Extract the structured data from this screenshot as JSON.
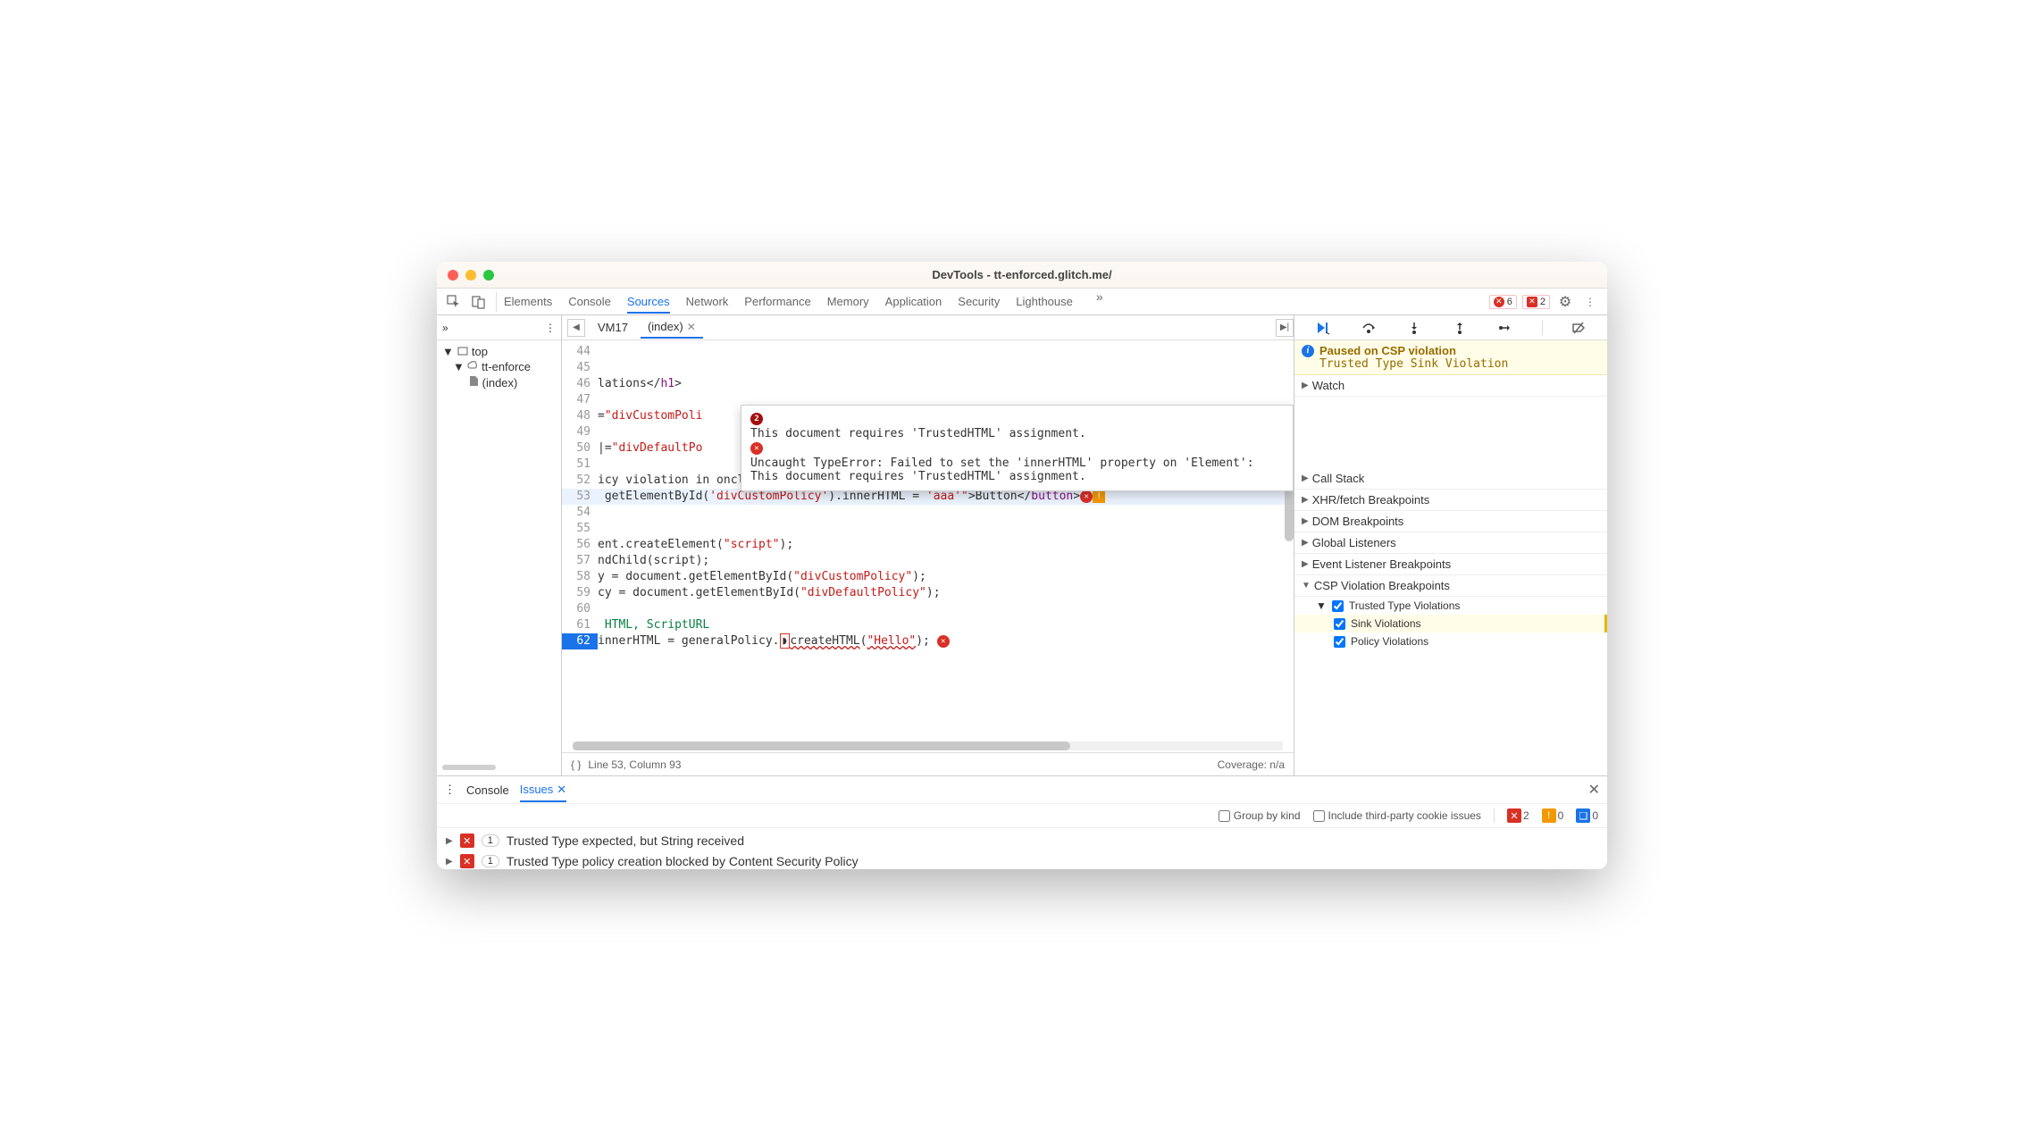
{
  "window": {
    "title": "DevTools - tt-enforced.glitch.me/"
  },
  "main_tabs": {
    "items": [
      "Elements",
      "Console",
      "Sources",
      "Network",
      "Performance",
      "Memory",
      "Application",
      "Security",
      "Lighthouse"
    ],
    "active": "Sources",
    "error_count": "6",
    "issue_count": "2"
  },
  "sidebar": {
    "top": "top",
    "origin": "tt-enforce",
    "file": "(index)"
  },
  "editor": {
    "tabs": {
      "vm": "VM17",
      "index": "(index)"
    },
    "footer_pos": "Line 53, Column 93",
    "footer_coverage": "Coverage: n/a",
    "lines": [
      {
        "n": "44",
        "t": ""
      },
      {
        "n": "45",
        "t": ""
      },
      {
        "n": "46",
        "pre": "lations</",
        "tag": "h1",
        "suf": ">"
      },
      {
        "n": "47",
        "t": ""
      },
      {
        "n": "48",
        "pre": "=",
        "str": "\"divCustomPoli"
      },
      {
        "n": "49",
        "t": ""
      },
      {
        "n": "50",
        "pre": "|=",
        "str": "\"divDefaultPo"
      },
      {
        "n": "51",
        "t": ""
      },
      {
        "n": "52",
        "raw": "icy violation in onclick: <button type=\"button\""
      },
      {
        "n": "53",
        "code": "getElementById('divCustomPolicy').innerHTML = 'aaa'\">Button</button>",
        "hl": true
      },
      {
        "n": "54",
        "t": ""
      },
      {
        "n": "55",
        "t": ""
      },
      {
        "n": "56",
        "code56": "ent.createElement(\"script\");"
      },
      {
        "n": "57",
        "code57": "ndChild(script);"
      },
      {
        "n": "58",
        "code58": "y = document.getElementById(\"divCustomPolicy\");"
      },
      {
        "n": "59",
        "code59": "cy = document.getElementById(\"divDefaultPolicy\");"
      },
      {
        "n": "60",
        "t": ""
      },
      {
        "n": "61",
        "cm": "HTML, ScriptURL"
      },
      {
        "n": "62",
        "code62": "innerHTML = generalPolicy.createHTML(\"Hello\");",
        "exec": true
      }
    ]
  },
  "tooltip": {
    "count": "2",
    "line1": "This document requires 'TrustedHTML' assignment.",
    "line2": "Uncaught TypeError: Failed to set the 'innerHTML' property on 'Element': This document requires 'TrustedHTML' assignment."
  },
  "debug": {
    "paused_title": "Paused on CSP violation",
    "paused_sub": "Trusted Type Sink Violation",
    "sections": {
      "watch": "Watch",
      "callstack": "Call Stack",
      "xhr": "XHR/fetch Breakpoints",
      "dom": "DOM Breakpoints",
      "global": "Global Listeners",
      "event": "Event Listener Breakpoints",
      "csp": "CSP Violation Breakpoints",
      "trusted": "Trusted Type Violations",
      "sink": "Sink Violations",
      "policy": "Policy Violations"
    }
  },
  "drawer": {
    "console_tab": "Console",
    "issues_tab": "Issues",
    "group_label": "Group by kind",
    "third_party_label": "Include third-party cookie issues",
    "counts": {
      "err": "2",
      "warn": "0",
      "info": "0"
    },
    "issue1": "Trusted Type expected, but String received",
    "issue1_count": "1",
    "issue2": "Trusted Type policy creation blocked by Content Security Policy"
  }
}
